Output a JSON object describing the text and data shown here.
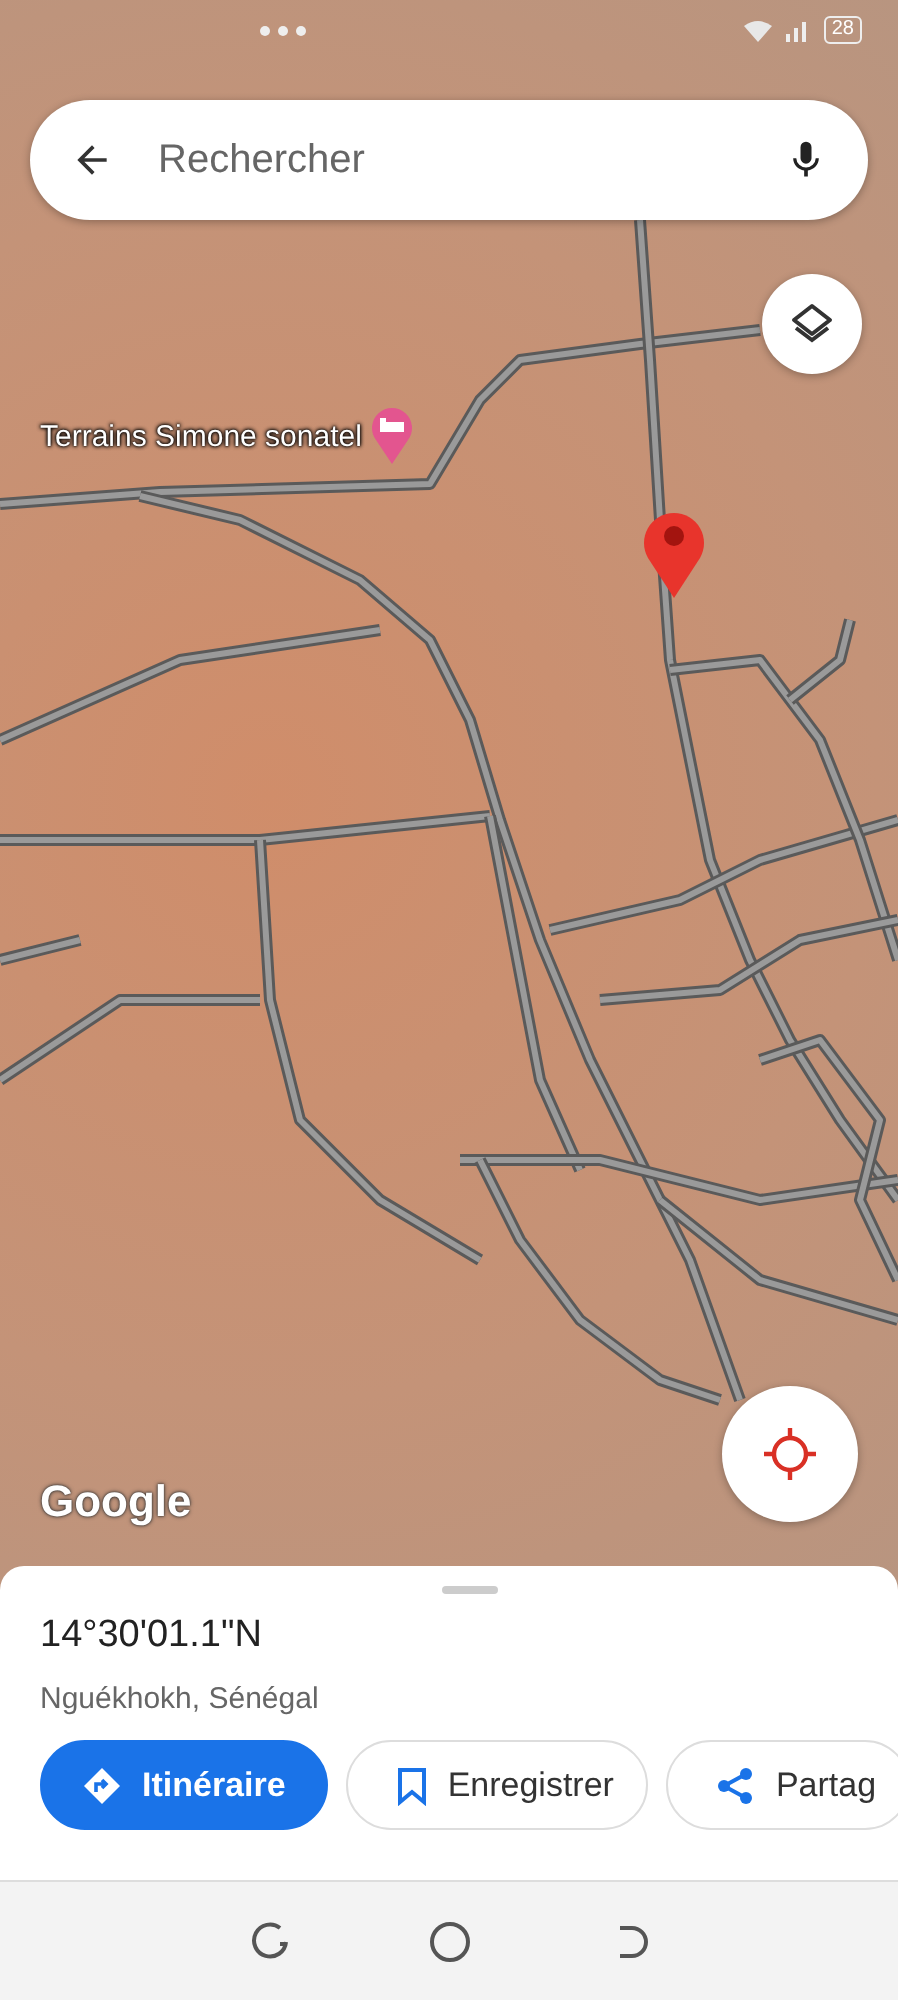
{
  "status_bar": {
    "battery": "28"
  },
  "search": {
    "placeholder": "Rechercher"
  },
  "map": {
    "place_label": "Terrains Simone sonatel",
    "logo": "Google"
  },
  "place": {
    "coordinates": "14°30'01.1\"N",
    "locality": "Nguékhokh, Sénégal"
  },
  "actions": [
    {
      "label": "Itinéraire",
      "kind": "primary"
    },
    {
      "label": "Enregistrer",
      "kind": "save"
    },
    {
      "label": "Partag",
      "kind": "share"
    }
  ]
}
